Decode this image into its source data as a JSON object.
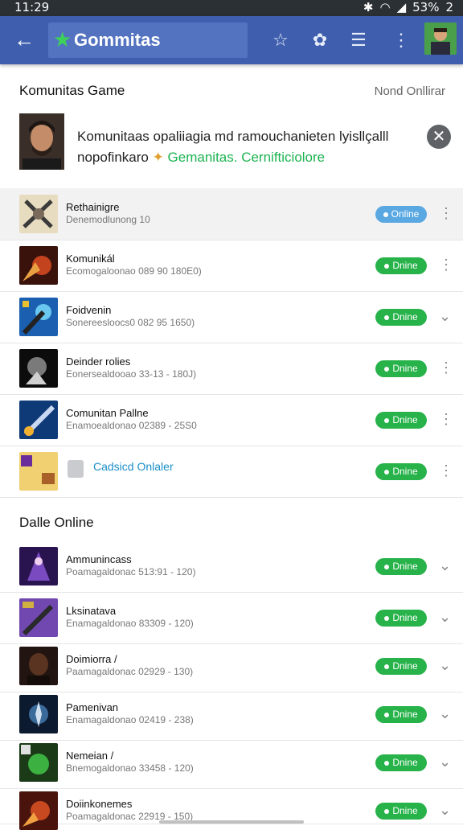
{
  "status": {
    "time": "11:29",
    "battery": "53%",
    "battery_num": "2"
  },
  "appbar": {
    "title": "Gommitas"
  },
  "section1": {
    "title": "Komunitas Game",
    "action": "Nond Onllirar"
  },
  "feature": {
    "line1": "Komunitaas opaliiagia md ramouchanieten lyisllçalll",
    "line2": "nopofinkaro",
    "green_text": "Gemanitas. Cernifticiolore"
  },
  "section2": {
    "title": "Dalle Online"
  },
  "list1": [
    {
      "name": "Rethainigre",
      "sub": "Denemodlunong 10",
      "status": "Online",
      "color": "blue",
      "trail": "more",
      "thumb": "#d7c8a8"
    },
    {
      "name": "Komunikál",
      "sub": "Ecomogaloonao 089 90 180E0)",
      "status": "Dnine",
      "color": "green",
      "trail": "more",
      "thumb": "#5a1e14"
    },
    {
      "name": "Foidvenin",
      "sub": "Sonereesloocs0 082 95 1650)",
      "status": "Dnine",
      "color": "green",
      "trail": "chevron",
      "thumb": "#1f5ea8"
    },
    {
      "name": "Deinder rolies",
      "sub": "Eonersealdooao 33-13 - 180J)",
      "status": "Dnine",
      "color": "green",
      "trail": "more",
      "thumb": "#3a3a3a"
    },
    {
      "name": "Comunitan Pallne",
      "sub": "Enamoealdonao 02389 - 25S0",
      "status": "Dnine",
      "color": "green",
      "trail": "more",
      "thumb": "#1d4c8c"
    },
    {
      "name": "Cadsicd Onlaler",
      "sub": "",
      "status": "Dnine",
      "color": "green",
      "trail": "more",
      "thumb": "#e8c24a",
      "link": true
    }
  ],
  "list2": [
    {
      "name": "Ammunincass",
      "sub": "Poamagaldonac 513:91 - 120)",
      "status": "Dnine",
      "trail": "chevron",
      "thumb": "#3b1e6a"
    },
    {
      "name": "Lksinatava",
      "sub": "Enamagaldonao 83309 - 120)",
      "status": "Dnine",
      "trail": "chevron",
      "thumb": "#5c3a8e"
    },
    {
      "name": "Doimiorra /",
      "sub": "Paamagaldonac 02929 - 130)",
      "status": "Dnine",
      "trail": "chevron",
      "thumb": "#4a2a18"
    },
    {
      "name": "Pamenivan",
      "sub": "Enamagaldonao 02419 - 238)",
      "status": "Dnine",
      "trail": "chevron",
      "thumb": "#1d3a5e"
    },
    {
      "name": "Nemeian /",
      "sub": "Bnemogaldonao 33458 - 120)",
      "status": "Dnine",
      "trail": "chevron",
      "thumb": "#1e5a2a"
    },
    {
      "name": "Doiinkonemes",
      "sub": "Poamagaldonac 22919 - 150)",
      "status": "Dnine",
      "trail": "chevron",
      "thumb": "#6a1e10"
    }
  ]
}
